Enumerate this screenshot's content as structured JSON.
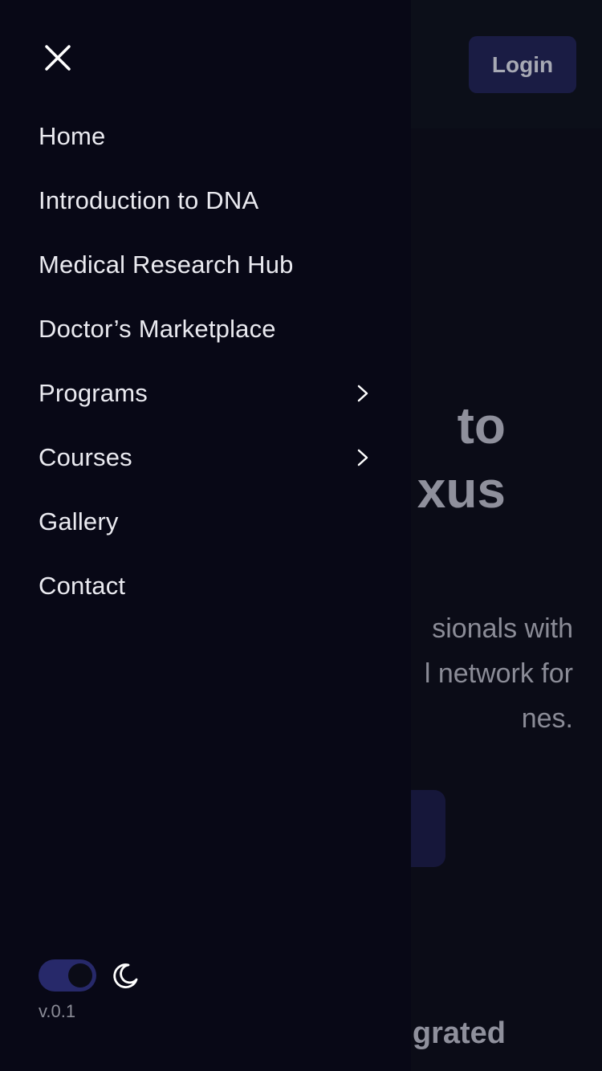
{
  "background": {
    "login_label": "Login",
    "hero_title_visible": "to\nxus",
    "hero_desc_visible": "sionals with\nl network for\nnes.",
    "section_title_visible": "grated"
  },
  "drawer": {
    "close_icon": "close-icon",
    "nav": [
      {
        "label": "Home",
        "has_submenu": false
      },
      {
        "label": "Introduction to DNA",
        "has_submenu": false
      },
      {
        "label": "Medical Research Hub",
        "has_submenu": false
      },
      {
        "label": "Doctor’s Marketplace",
        "has_submenu": false
      },
      {
        "label": "Programs",
        "has_submenu": true
      },
      {
        "label": "Courses",
        "has_submenu": true
      },
      {
        "label": "Gallery",
        "has_submenu": false
      },
      {
        "label": "Contact",
        "has_submenu": false
      }
    ],
    "theme_toggle": {
      "state": "dark",
      "icon": "moon-icon"
    },
    "version": "v.0.1"
  },
  "colors": {
    "drawer_bg": "#080816",
    "page_bg": "#0b0c17",
    "accent": "#27296a",
    "login_bg": "#1a1c44"
  }
}
